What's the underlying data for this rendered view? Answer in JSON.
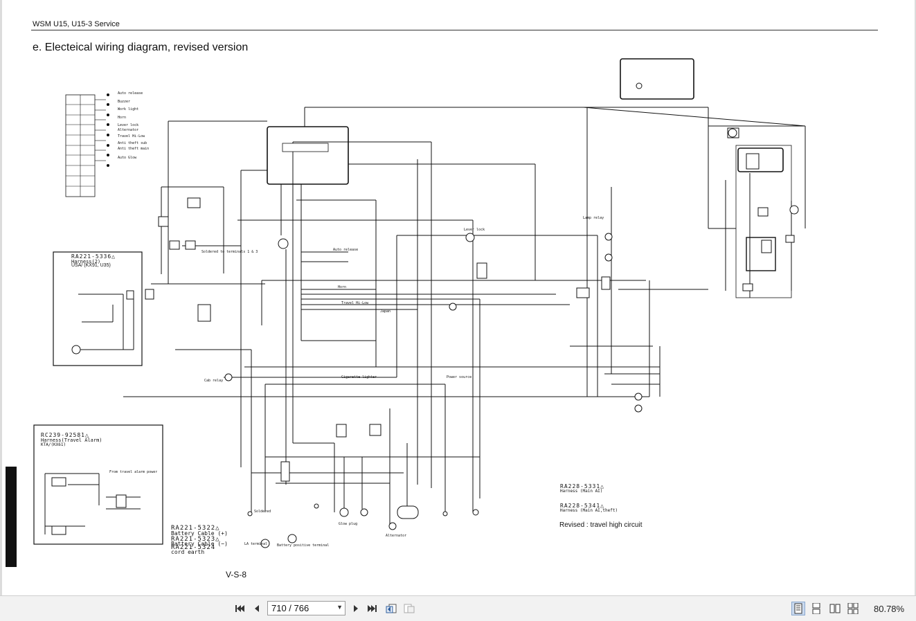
{
  "document": {
    "header": "WSM U15, U15-3 Service",
    "title": "e. Electeical wiring diagram, revised version",
    "page_label": "V-S-8",
    "revised_note": "Revised : travel high circuit"
  },
  "harnesses": {
    "h1_part": "RA221-5336△",
    "h1_name": "Harness(2)",
    "h1_model": "USA/ (KX91, U35)",
    "h2_part": "RC239-92581△",
    "h2_name": "Harness(Travel Alarm)",
    "h2_model": "KTA/(KX61)",
    "h3_part": "RA228-5331△",
    "h3_name": "Harness (Main AI)",
    "h4_part": "RA228-5341△",
    "h4_name": "Harness (Main AI,theft)",
    "cable1_part": "RA221-5322△",
    "cable1_name": "Battery Cable (+)",
    "cable2_part": "RA221-5323△",
    "cable2_name": "Battery Cable (−)",
    "cable3_part": "RA221-5324",
    "cable3_name": "cord earth"
  },
  "component_labels": {
    "solder_note": "Soldered to terminals 1 & 3",
    "lever_lock": "Lever lock",
    "travel_hi_low": "Travel Hi-Low",
    "horn": "Horn",
    "auto_release": "Auto release",
    "cigarette_lighter": "Cigarette lighter",
    "power_source": "Power source",
    "japan": "Japan",
    "soldered": "Soldered",
    "glow_plug": "Glow plug",
    "alternator": "Alternator",
    "battery_positive": "Battery positive terminal",
    "la_terminal": "LA terminal",
    "cab_relay": "Cab relay",
    "travel_alarm_power": "From travel alarm power",
    "lamp_relay": "Lamp relay",
    "legend_auto_release": "Auto release",
    "legend_buzzer": "Buzzer",
    "legend_work_light": "Work light",
    "legend_horn": "Horn",
    "legend_lever_lock": "Lever lock",
    "legend_alternator": "Alternator",
    "legend_travel": "Travel Hi-Low",
    "legend_anti_theft_sub": "Anti theft sub",
    "legend_anti_theft_main": "Anti theft main",
    "legend_auto_glow": "Auto Glow"
  },
  "toolbar": {
    "page_field": "710 / 766",
    "zoom": "80.78%"
  },
  "icons": {
    "first": "first-page-icon",
    "prev": "previous-page-icon",
    "next": "next-page-icon",
    "last": "last-page-icon",
    "back": "go-back-icon",
    "forward": "go-forward-icon",
    "single_page": "single-page-view-icon",
    "continuous": "continuous-view-icon",
    "facing": "facing-view-icon",
    "continuous_facing": "continuous-facing-view-icon"
  },
  "colors": {
    "toolbar_bg": "#f2f2f2",
    "active_view": "#c9d9ee",
    "wire": "#111111"
  }
}
